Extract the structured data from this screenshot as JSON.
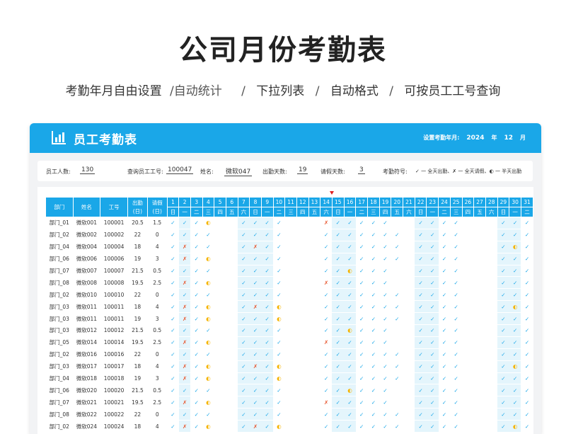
{
  "page": {
    "title": "公司月份考勤表",
    "subtitle_items": [
      "考勤年月自由设置",
      "/自动统计",
      "下拉列表",
      "自动格式",
      "可按员工工号查询"
    ],
    "subtitle_sep": "/"
  },
  "header": {
    "title": "员工考勤表",
    "period_label": "设置考勤年月:",
    "year": "2024",
    "year_unit": "年",
    "month": "12",
    "month_unit": "月",
    "icon": "bar-chart-icon",
    "accent_color": "#1aa7e8"
  },
  "info": {
    "staff_count_label": "员工人数:",
    "staff_count": "130",
    "query_label": "查询员工工号:",
    "query_value": "100047",
    "name_label": "姓名:",
    "name_value": "微软047",
    "attend_label": "出勤天数:",
    "attend_value": "19",
    "leave_label": "请假天数:",
    "leave_value": "3",
    "symbol_label": "考勤符号:",
    "symbol_legend": "✓ 一 全天出勤、✗ 一 全天请假、◐ 一 半天出勤"
  },
  "table": {
    "col_dept": "部门",
    "col_name": "姓名",
    "col_id": "工号",
    "col_attend": "出勤\n(日)",
    "col_leave": "请假\n(日)",
    "days": [
      "1",
      "2",
      "3",
      "4",
      "5",
      "6",
      "7",
      "8",
      "9",
      "10",
      "11",
      "12",
      "13",
      "14",
      "15",
      "16",
      "17",
      "18",
      "19",
      "20",
      "21",
      "22",
      "23",
      "24",
      "25",
      "26",
      "27",
      "28",
      "29",
      "30",
      "31"
    ],
    "weekdays": [
      "日",
      "一",
      "二",
      "三",
      "四",
      "五",
      "六",
      "日",
      "一",
      "二",
      "三",
      "四",
      "五",
      "六",
      "日",
      "一",
      "二",
      "三",
      "四",
      "五",
      "六",
      "日",
      "一",
      "二",
      "三",
      "四",
      "五",
      "六",
      "日",
      "一",
      "二"
    ],
    "weekend_cols": [
      1,
      6,
      7,
      8,
      14,
      15,
      21,
      22,
      28,
      29
    ],
    "marked_day": "15",
    "symbols": {
      "c": "✓",
      "x": "✗",
      "h": "◐"
    },
    "rows": [
      {
        "dept": "部门_01",
        "name": "微软001",
        "id": "100001",
        "attend": "20.5",
        "leave": "1.5",
        "marks": "ccch--cccc---xccccc--cccc---ccc"
      },
      {
        "dept": "部门_02",
        "name": "微软002",
        "id": "100002",
        "attend": "22",
        "leave": "0",
        "marks": "cccc--cccc---ccccccc-cccc---ccc"
      },
      {
        "dept": "部门_04",
        "name": "微软004",
        "id": "100004",
        "attend": "18",
        "leave": "4",
        "marks": "cxcc--cxcc---ccccccc-cccc---chc"
      },
      {
        "dept": "部门_06",
        "name": "微软006",
        "id": "100006",
        "attend": "19",
        "leave": "3",
        "marks": "cxch--cccc---ccccccc-cccc---ccc"
      },
      {
        "dept": "部门_07",
        "name": "微软007",
        "id": "100007",
        "attend": "21.5",
        "leave": "0.5",
        "marks": "cccc--cccc---cchccc--cccc---ccc"
      },
      {
        "dept": "部门_08",
        "name": "微软008",
        "id": "100008",
        "attend": "19.5",
        "leave": "2.5",
        "marks": "cxch--cccc---xccccc--cccc---ccc"
      },
      {
        "dept": "部门_02",
        "name": "微软010",
        "id": "100010",
        "attend": "22",
        "leave": "0",
        "marks": "cccc--cccc---ccccccc-cccc---ccc"
      },
      {
        "dept": "部门_03",
        "name": "微软011",
        "id": "100011",
        "attend": "18",
        "leave": "4",
        "marks": "cxch--cxch---ccccccc-cccc---chc"
      },
      {
        "dept": "部门_03",
        "name": "微软011",
        "id": "100011",
        "attend": "19",
        "leave": "3",
        "marks": "cxch--ccch---ccccccc-cccc---ccc"
      },
      {
        "dept": "部门_03",
        "name": "微软012",
        "id": "100012",
        "attend": "21.5",
        "leave": "0.5",
        "marks": "cccc--cccc---cchccc--cccc---ccc"
      },
      {
        "dept": "部门_05",
        "name": "微软014",
        "id": "100014",
        "attend": "19.5",
        "leave": "2.5",
        "marks": "cxch--cccc---xccccc--cccc---ccc"
      },
      {
        "dept": "部门_02",
        "name": "微软016",
        "id": "100016",
        "attend": "22",
        "leave": "0",
        "marks": "cccc--cccc---ccccccc-cccc---ccc"
      },
      {
        "dept": "部门_03",
        "name": "微软017",
        "id": "100017",
        "attend": "18",
        "leave": "4",
        "marks": "cxch--cxch---ccccccc-cccc---chc"
      },
      {
        "dept": "部门_04",
        "name": "微软018",
        "id": "100018",
        "attend": "19",
        "leave": "3",
        "marks": "cxch--ccch---ccccccc-cccc---ccc"
      },
      {
        "dept": "部门_06",
        "name": "微软020",
        "id": "100020",
        "attend": "21.5",
        "leave": "0.5",
        "marks": "cccc--cccc---cchccc--cccc---ccc"
      },
      {
        "dept": "部门_07",
        "name": "微软021",
        "id": "100021",
        "attend": "19.5",
        "leave": "2.5",
        "marks": "cxch--cccc---xccccc--cccc---ccc"
      },
      {
        "dept": "部门_08",
        "name": "微软022",
        "id": "100022",
        "attend": "22",
        "leave": "0",
        "marks": "cccc--cccc---ccccccc-cccc---ccc"
      },
      {
        "dept": "部门_02",
        "name": "微软024",
        "id": "100024",
        "attend": "18",
        "leave": "4",
        "marks": "cxch--cxch---ccccccc-cccc---chc"
      }
    ]
  }
}
